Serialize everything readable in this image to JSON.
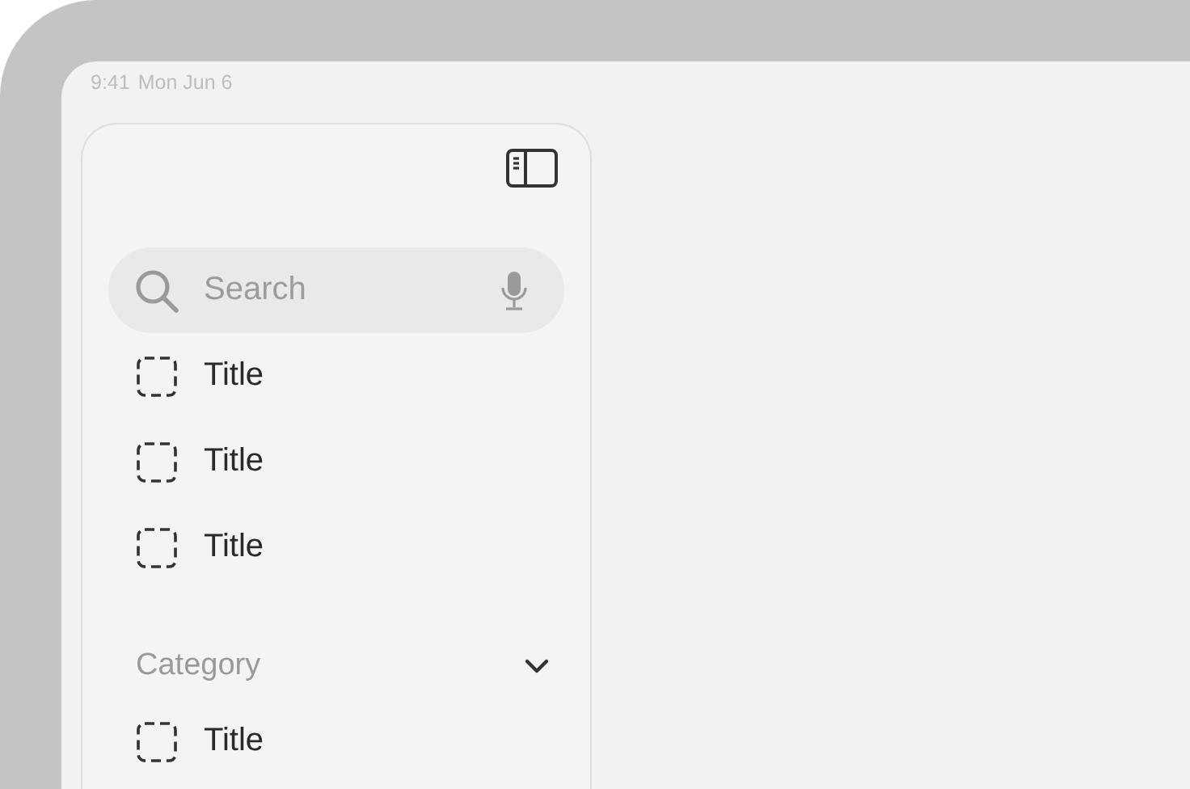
{
  "status_bar": {
    "time": "9:41",
    "date": "Mon Jun 6"
  },
  "sidebar": {
    "search": {
      "placeholder": "Search"
    },
    "items": [
      {
        "label": "Title"
      },
      {
        "label": "Title"
      },
      {
        "label": "Title"
      }
    ],
    "sections": [
      {
        "title": "Category",
        "expanded": true,
        "items": [
          {
            "label": "Title"
          }
        ]
      }
    ]
  }
}
